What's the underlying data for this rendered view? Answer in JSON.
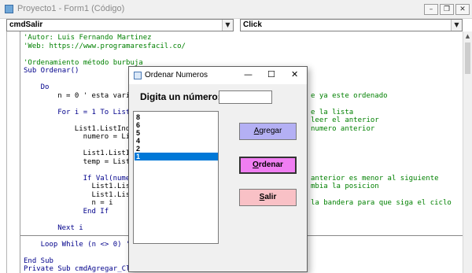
{
  "ide": {
    "title": "Proyecto1 - Form1 (Código)",
    "object_combo": "cmdSalir",
    "proc_combo": "Click",
    "window_buttons": {
      "minimize": "–",
      "restore": "❐",
      "close": "✕"
    }
  },
  "code": [
    {
      "indent": 0,
      "type": "cmt",
      "text": "'Autor: Luis Fernando Martinez"
    },
    {
      "indent": 0,
      "type": "cmt",
      "text": "'Web: https://www.programaresfacil.co/"
    },
    {
      "indent": 0,
      "type": "blank",
      "text": ""
    },
    {
      "indent": 0,
      "type": "cmt",
      "text": "'Ordenamiento método burbuja"
    },
    {
      "indent": 0,
      "type": "kw",
      "text": "Sub Ordenar()"
    },
    {
      "indent": 0,
      "type": "blank",
      "text": ""
    },
    {
      "indent": 4,
      "type": "kw",
      "text": "Do"
    },
    {
      "indent": 8,
      "type": "txt",
      "text": "n = 0 ' esta vari"
    },
    {
      "indent": 0,
      "type": "blank",
      "text": ""
    },
    {
      "indent": 8,
      "type": "kw",
      "text": "For i = 1 To List"
    },
    {
      "indent": 0,
      "type": "blank",
      "text": ""
    },
    {
      "indent": 12,
      "type": "txt",
      "text": "List1.ListInd"
    },
    {
      "indent": 12,
      "type": "txt",
      "text": "  numero = Lis"
    },
    {
      "indent": 0,
      "type": "blank",
      "text": ""
    },
    {
      "indent": 12,
      "type": "txt",
      "text": "  List1.ListIn"
    },
    {
      "indent": 12,
      "type": "txt",
      "text": "  temp = List1"
    },
    {
      "indent": 0,
      "type": "blank",
      "text": ""
    },
    {
      "indent": 12,
      "type": "kw",
      "text": "  If Val(numer"
    },
    {
      "indent": 12,
      "type": "txt",
      "text": "    List1.Lis"
    },
    {
      "indent": 12,
      "type": "txt",
      "text": "    List1.Lis"
    },
    {
      "indent": 12,
      "type": "txt",
      "text": "    n = i"
    },
    {
      "indent": 12,
      "type": "kw",
      "text": "  End If"
    },
    {
      "indent": 0,
      "type": "blank",
      "text": ""
    },
    {
      "indent": 8,
      "type": "kw",
      "text": "Next i"
    },
    {
      "indent": 0,
      "type": "blank",
      "text": ""
    },
    {
      "indent": 4,
      "type": "kw",
      "text": "Loop While (n <> 0) '"
    },
    {
      "indent": 0,
      "type": "blank",
      "text": ""
    },
    {
      "indent": 0,
      "type": "kw",
      "text": "End Sub"
    },
    {
      "indent": 0,
      "type": "kw",
      "text": "Private Sub cmdAgregar_Click()"
    }
  ],
  "code_right": [
    {
      "line": 7,
      "text": "e ya este ordenado"
    },
    {
      "line": 9,
      "text": "e la lista"
    },
    {
      "line": 10,
      "text": "leer el anterior"
    },
    {
      "line": 11,
      "text": "numero anterior"
    },
    {
      "line": 17,
      "text": "anterior es menor al siguiente"
    },
    {
      "line": 18,
      "text": "mbia la posicion"
    },
    {
      "line": 20,
      "text": "la bandera para que siga el ciclo"
    }
  ],
  "dialog": {
    "title": "Ordenar Numeros",
    "controls": {
      "minimize": "—",
      "maximize": "☐",
      "close": "✕"
    },
    "prompt": "Digita un número:",
    "input_value": "",
    "list_items": [
      "8",
      "6",
      "5",
      "4",
      "2",
      "1"
    ],
    "selected_index": 5,
    "buttons": {
      "add": {
        "mn": "A",
        "rest": "gregar"
      },
      "sort": {
        "mn": "O",
        "rest": "rdenar"
      },
      "exit": {
        "mn": "S",
        "rest": "alir"
      }
    }
  },
  "colors": {
    "comment": "#008000",
    "keyword": "#00008b",
    "add_button": "#b4b0f4",
    "sort_button": "#f07ef2",
    "exit_button": "#f9c1c6",
    "selection": "#0078d7"
  }
}
